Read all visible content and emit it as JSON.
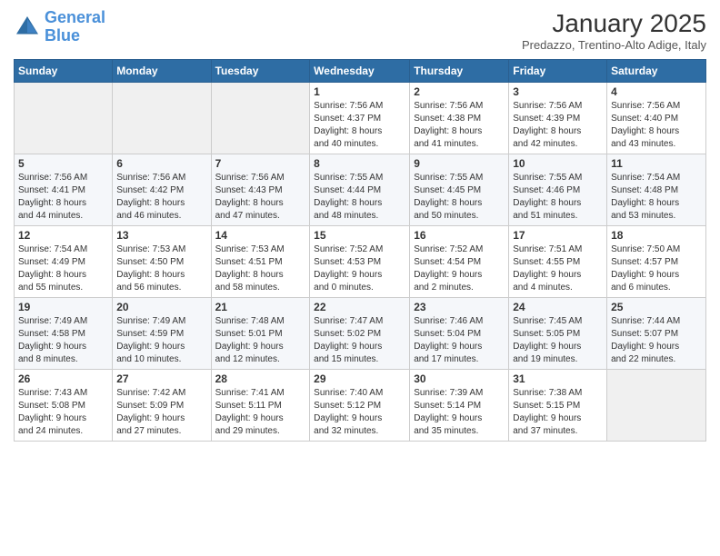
{
  "header": {
    "logo": {
      "line1": "General",
      "line2": "Blue"
    },
    "title": "January 2025",
    "subtitle": "Predazzo, Trentino-Alto Adige, Italy"
  },
  "weekdays": [
    "Sunday",
    "Monday",
    "Tuesday",
    "Wednesday",
    "Thursday",
    "Friday",
    "Saturday"
  ],
  "weeks": [
    [
      {
        "day": "",
        "info": ""
      },
      {
        "day": "",
        "info": ""
      },
      {
        "day": "",
        "info": ""
      },
      {
        "day": "1",
        "info": "Sunrise: 7:56 AM\nSunset: 4:37 PM\nDaylight: 8 hours\nand 40 minutes."
      },
      {
        "day": "2",
        "info": "Sunrise: 7:56 AM\nSunset: 4:38 PM\nDaylight: 8 hours\nand 41 minutes."
      },
      {
        "day": "3",
        "info": "Sunrise: 7:56 AM\nSunset: 4:39 PM\nDaylight: 8 hours\nand 42 minutes."
      },
      {
        "day": "4",
        "info": "Sunrise: 7:56 AM\nSunset: 4:40 PM\nDaylight: 8 hours\nand 43 minutes."
      }
    ],
    [
      {
        "day": "5",
        "info": "Sunrise: 7:56 AM\nSunset: 4:41 PM\nDaylight: 8 hours\nand 44 minutes."
      },
      {
        "day": "6",
        "info": "Sunrise: 7:56 AM\nSunset: 4:42 PM\nDaylight: 8 hours\nand 46 minutes."
      },
      {
        "day": "7",
        "info": "Sunrise: 7:56 AM\nSunset: 4:43 PM\nDaylight: 8 hours\nand 47 minutes."
      },
      {
        "day": "8",
        "info": "Sunrise: 7:55 AM\nSunset: 4:44 PM\nDaylight: 8 hours\nand 48 minutes."
      },
      {
        "day": "9",
        "info": "Sunrise: 7:55 AM\nSunset: 4:45 PM\nDaylight: 8 hours\nand 50 minutes."
      },
      {
        "day": "10",
        "info": "Sunrise: 7:55 AM\nSunset: 4:46 PM\nDaylight: 8 hours\nand 51 minutes."
      },
      {
        "day": "11",
        "info": "Sunrise: 7:54 AM\nSunset: 4:48 PM\nDaylight: 8 hours\nand 53 minutes."
      }
    ],
    [
      {
        "day": "12",
        "info": "Sunrise: 7:54 AM\nSunset: 4:49 PM\nDaylight: 8 hours\nand 55 minutes."
      },
      {
        "day": "13",
        "info": "Sunrise: 7:53 AM\nSunset: 4:50 PM\nDaylight: 8 hours\nand 56 minutes."
      },
      {
        "day": "14",
        "info": "Sunrise: 7:53 AM\nSunset: 4:51 PM\nDaylight: 8 hours\nand 58 minutes."
      },
      {
        "day": "15",
        "info": "Sunrise: 7:52 AM\nSunset: 4:53 PM\nDaylight: 9 hours\nand 0 minutes."
      },
      {
        "day": "16",
        "info": "Sunrise: 7:52 AM\nSunset: 4:54 PM\nDaylight: 9 hours\nand 2 minutes."
      },
      {
        "day": "17",
        "info": "Sunrise: 7:51 AM\nSunset: 4:55 PM\nDaylight: 9 hours\nand 4 minutes."
      },
      {
        "day": "18",
        "info": "Sunrise: 7:50 AM\nSunset: 4:57 PM\nDaylight: 9 hours\nand 6 minutes."
      }
    ],
    [
      {
        "day": "19",
        "info": "Sunrise: 7:49 AM\nSunset: 4:58 PM\nDaylight: 9 hours\nand 8 minutes."
      },
      {
        "day": "20",
        "info": "Sunrise: 7:49 AM\nSunset: 4:59 PM\nDaylight: 9 hours\nand 10 minutes."
      },
      {
        "day": "21",
        "info": "Sunrise: 7:48 AM\nSunset: 5:01 PM\nDaylight: 9 hours\nand 12 minutes."
      },
      {
        "day": "22",
        "info": "Sunrise: 7:47 AM\nSunset: 5:02 PM\nDaylight: 9 hours\nand 15 minutes."
      },
      {
        "day": "23",
        "info": "Sunrise: 7:46 AM\nSunset: 5:04 PM\nDaylight: 9 hours\nand 17 minutes."
      },
      {
        "day": "24",
        "info": "Sunrise: 7:45 AM\nSunset: 5:05 PM\nDaylight: 9 hours\nand 19 minutes."
      },
      {
        "day": "25",
        "info": "Sunrise: 7:44 AM\nSunset: 5:07 PM\nDaylight: 9 hours\nand 22 minutes."
      }
    ],
    [
      {
        "day": "26",
        "info": "Sunrise: 7:43 AM\nSunset: 5:08 PM\nDaylight: 9 hours\nand 24 minutes."
      },
      {
        "day": "27",
        "info": "Sunrise: 7:42 AM\nSunset: 5:09 PM\nDaylight: 9 hours\nand 27 minutes."
      },
      {
        "day": "28",
        "info": "Sunrise: 7:41 AM\nSunset: 5:11 PM\nDaylight: 9 hours\nand 29 minutes."
      },
      {
        "day": "29",
        "info": "Sunrise: 7:40 AM\nSunset: 5:12 PM\nDaylight: 9 hours\nand 32 minutes."
      },
      {
        "day": "30",
        "info": "Sunrise: 7:39 AM\nSunset: 5:14 PM\nDaylight: 9 hours\nand 35 minutes."
      },
      {
        "day": "31",
        "info": "Sunrise: 7:38 AM\nSunset: 5:15 PM\nDaylight: 9 hours\nand 37 minutes."
      },
      {
        "day": "",
        "info": ""
      }
    ]
  ]
}
